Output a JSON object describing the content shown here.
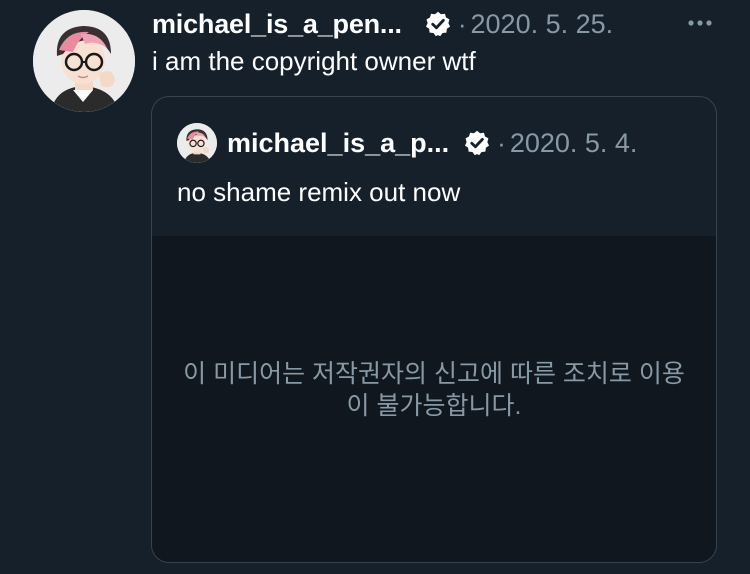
{
  "tweet": {
    "display_name": "michael_is_a_pen...",
    "verified_icon": "verified-badge-icon",
    "separator": "·",
    "date": "2020. 5. 25.",
    "more_icon": "more-horizontal-icon",
    "text": "i am the copyright owner wtf"
  },
  "quoted_tweet": {
    "display_name": "michael_is_a_p...",
    "verified_icon": "verified-badge-icon",
    "separator": "·",
    "date": "2020. 5. 4.",
    "text": "no shame remix out now",
    "media_notice": "이 미디어는 저작권자의 신고에 따른 조치로 이용이 불가능합니다."
  },
  "colors": {
    "background": "#15202b",
    "media_background": "#10171e",
    "secondary_text": "#8899a6",
    "border": "#38444d",
    "primary_text": "#ffffff"
  }
}
